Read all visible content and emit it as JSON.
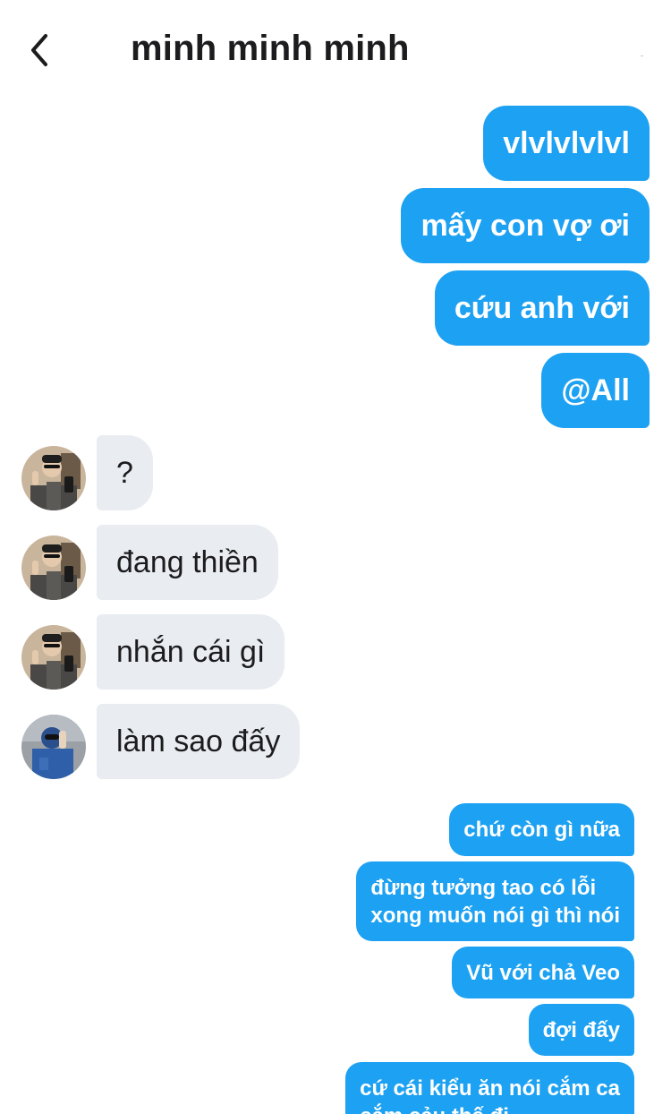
{
  "header": {
    "title": "minh minh minh"
  },
  "icons": {
    "back": "chevron-left-icon"
  },
  "colors": {
    "outgoing_bubble": "#1da1f2",
    "incoming_bubble": "#e9ecf0",
    "text_dark": "#1c1c1e"
  },
  "messages_top_outgoing": [
    {
      "text": "vlvlvlvlvl"
    },
    {
      "text": "mấy con vợ ơi"
    },
    {
      "text": "cứu anh với"
    },
    {
      "text": "@All"
    }
  ],
  "messages_incoming": [
    {
      "text": "?",
      "avatar": "avatar-1"
    },
    {
      "text": "đang thiền",
      "avatar": "avatar-1"
    },
    {
      "text": "nhắn cái gì",
      "avatar": "avatar-1"
    },
    {
      "text": "làm sao đấy",
      "avatar": "avatar-2"
    }
  ],
  "messages_bottom_outgoing": [
    {
      "text": "chứ còn gì nữa"
    },
    {
      "lines": [
        "đừng tưởng tao có lỗi",
        "xong muốn nói gì thì nói"
      ]
    },
    {
      "text": "Vũ với chả Veo"
    },
    {
      "text": "đợi đấy"
    },
    {
      "lines": [
        "cứ cái kiểu ăn nói cắm ca",
        "cắm cảu thế đi"
      ]
    }
  ]
}
